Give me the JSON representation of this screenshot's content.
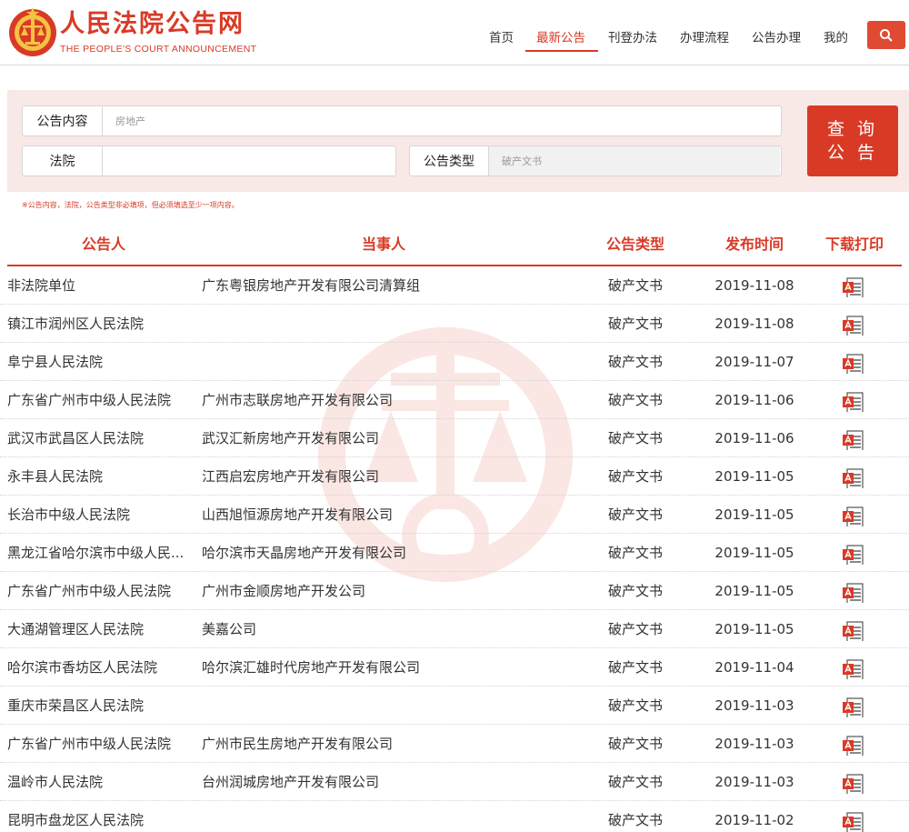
{
  "brand": {
    "title": "人民法院公告网",
    "subtitle": "THE PEOPLE'S COURT ANNOUNCEMENT"
  },
  "nav": {
    "items": [
      "首页",
      "最新公告",
      "刊登办法",
      "办理流程",
      "公告办理",
      "我的"
    ],
    "active": "最新公告"
  },
  "search": {
    "content_label": "公告内容",
    "content_value": "房地产",
    "court_label": "法院",
    "court_value": "",
    "type_label": "公告类型",
    "type_value": "破产文书",
    "button_label_line1": "查 询",
    "button_label_line2": "公 告",
    "hint": "※公告内容，法院，公告类型非必填项，但必须填选至少一项内容。"
  },
  "table": {
    "headers": [
      "公告人",
      "当事人",
      "公告类型",
      "发布时间",
      "下载打印"
    ],
    "rows": [
      {
        "publisher": "非法院单位",
        "party": "广东粤银房地产开发有限公司清算组",
        "type": "破产文书",
        "date": "2019-11-08"
      },
      {
        "publisher": "镇江市润州区人民法院",
        "party": "",
        "type": "破产文书",
        "date": "2019-11-08"
      },
      {
        "publisher": "阜宁县人民法院",
        "party": "",
        "type": "破产文书",
        "date": "2019-11-07"
      },
      {
        "publisher": "广东省广州市中级人民法院",
        "party": "广州市志联房地产开发有限公司",
        "type": "破产文书",
        "date": "2019-11-06"
      },
      {
        "publisher": "武汉市武昌区人民法院",
        "party": "武汉汇新房地产开发有限公司",
        "type": "破产文书",
        "date": "2019-11-06"
      },
      {
        "publisher": "永丰县人民法院",
        "party": "江西启宏房地产开发有限公司",
        "type": "破产文书",
        "date": "2019-11-05"
      },
      {
        "publisher": "长治市中级人民法院",
        "party": "山西旭恒源房地产开发有限公司",
        "type": "破产文书",
        "date": "2019-11-05"
      },
      {
        "publisher": "黑龙江省哈尔滨市中级人民...",
        "party": "哈尔滨市天晶房地产开发有限公司",
        "type": "破产文书",
        "date": "2019-11-05"
      },
      {
        "publisher": "广东省广州市中级人民法院",
        "party": "广州市金顺房地产开发公司",
        "type": "破产文书",
        "date": "2019-11-05"
      },
      {
        "publisher": "大通湖管理区人民法院",
        "party": "美嘉公司",
        "type": "破产文书",
        "date": "2019-11-05"
      },
      {
        "publisher": "哈尔滨市香坊区人民法院",
        "party": "哈尔滨汇雄时代房地产开发有限公司",
        "type": "破产文书",
        "date": "2019-11-04"
      },
      {
        "publisher": "重庆市荣昌区人民法院",
        "party": "",
        "type": "破产文书",
        "date": "2019-11-03"
      },
      {
        "publisher": "广东省广州市中级人民法院",
        "party": "广州市民生房地产开发有限公司",
        "type": "破产文书",
        "date": "2019-11-03"
      },
      {
        "publisher": "温岭市人民法院",
        "party": "台州润城房地产开发有限公司",
        "type": "破产文书",
        "date": "2019-11-03"
      },
      {
        "publisher": "昆明市盘龙区人民法院",
        "party": "",
        "type": "破产文书",
        "date": "2019-11-02"
      }
    ]
  },
  "icons": {
    "logo": "court-emblem-icon",
    "search": "search-icon",
    "download": "pdf-download-icon"
  },
  "colors": {
    "accent": "#d93a26",
    "panel_bg": "#f8e9e6"
  }
}
